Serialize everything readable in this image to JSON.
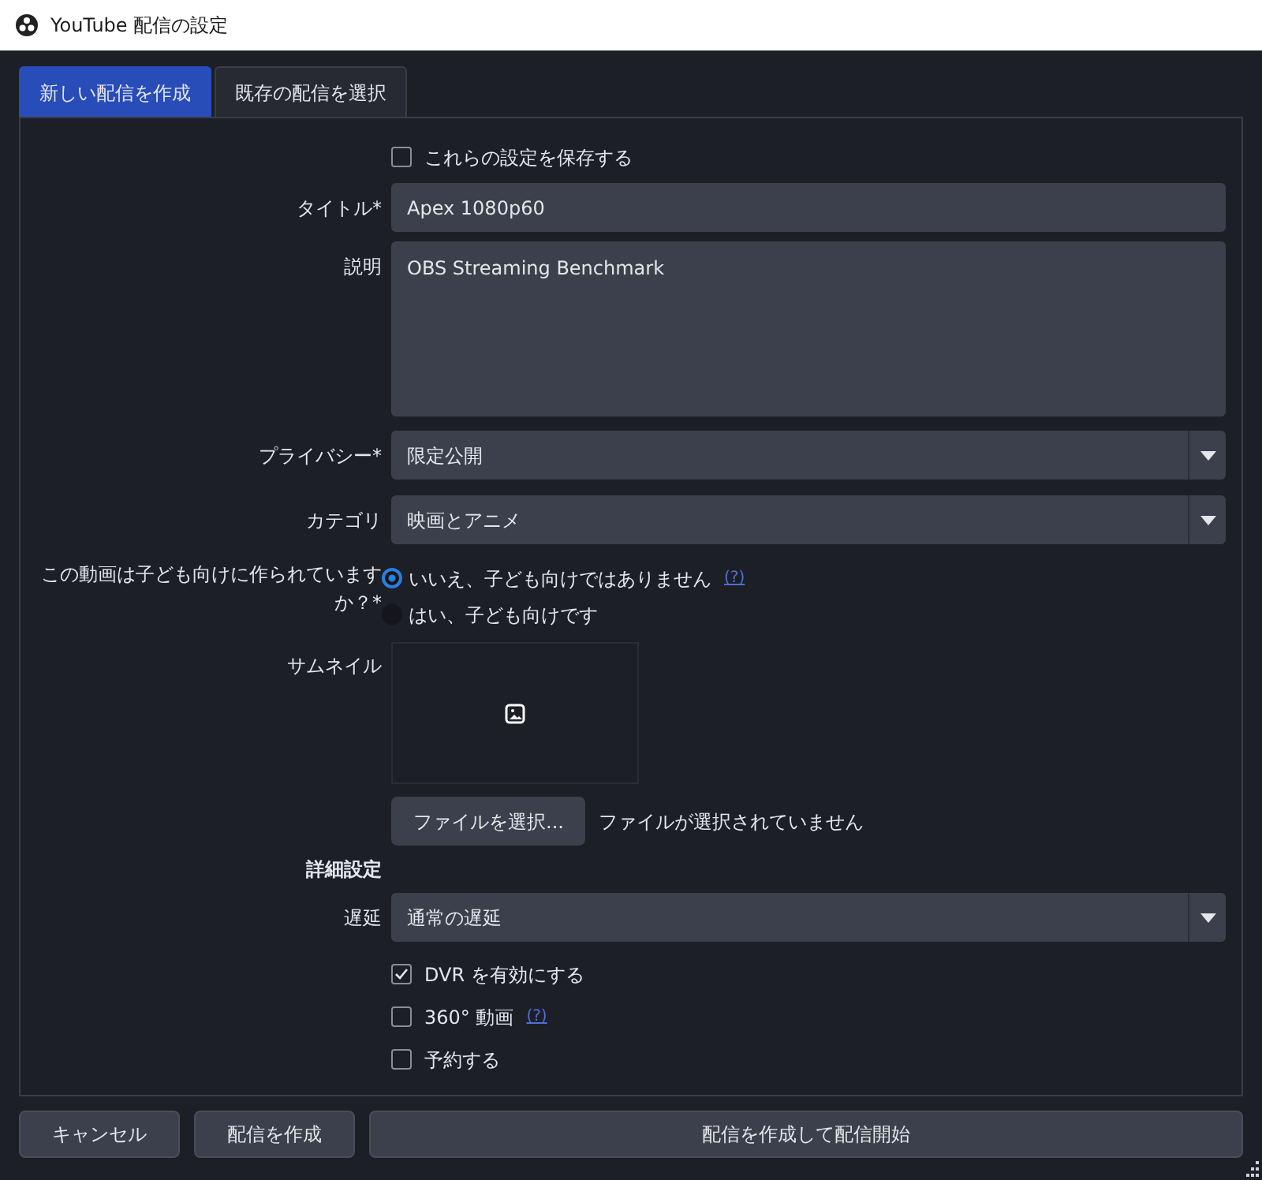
{
  "window": {
    "title": "YouTube 配信の設定"
  },
  "tabs": [
    {
      "label": "新しい配信を作成",
      "selected": true
    },
    {
      "label": "既存の配信を選択",
      "selected": false
    }
  ],
  "fields": [
    {
      "kind": "checkbox",
      "label": "これらの設定を保存する",
      "checked": false
    },
    {
      "kind": "text",
      "label": "タイトル*",
      "value": "Apex 1080p60"
    },
    {
      "kind": "textarea",
      "label": "説明",
      "value": "OBS Streaming Benchmark"
    },
    {
      "kind": "select",
      "label": "プライバシー*",
      "value": "限定公開"
    },
    {
      "kind": "select",
      "label": "カテゴリ",
      "value": "映画とアニメ"
    },
    {
      "kind": "radio",
      "label": "この動画は子ども向けに作られていますか？*",
      "options": [
        {
          "label": "いいえ、子ども向けではありません",
          "selected": true,
          "help": "(?)"
        },
        {
          "label": "はい、子ども向けです",
          "selected": false
        }
      ]
    },
    {
      "kind": "thumbnail",
      "label": "サムネイル",
      "button": "ファイルを選択...",
      "status": "ファイルが選択されていません"
    },
    {
      "kind": "heading",
      "label": "詳細設定"
    },
    {
      "kind": "select",
      "label": "遅延",
      "value": "通常の遅延"
    },
    {
      "kind": "checkbox",
      "label": "DVR を有効にする",
      "checked": true
    },
    {
      "kind": "checkbox",
      "label": "360° 動画",
      "checked": false,
      "help": "(?)"
    },
    {
      "kind": "checkbox",
      "label": "予約する",
      "checked": false
    }
  ],
  "buttons": [
    {
      "label": "キャンセル",
      "kind": "small"
    },
    {
      "label": "配信を作成",
      "kind": "small"
    },
    {
      "label": "配信を作成して配信開始",
      "kind": "wide"
    }
  ]
}
